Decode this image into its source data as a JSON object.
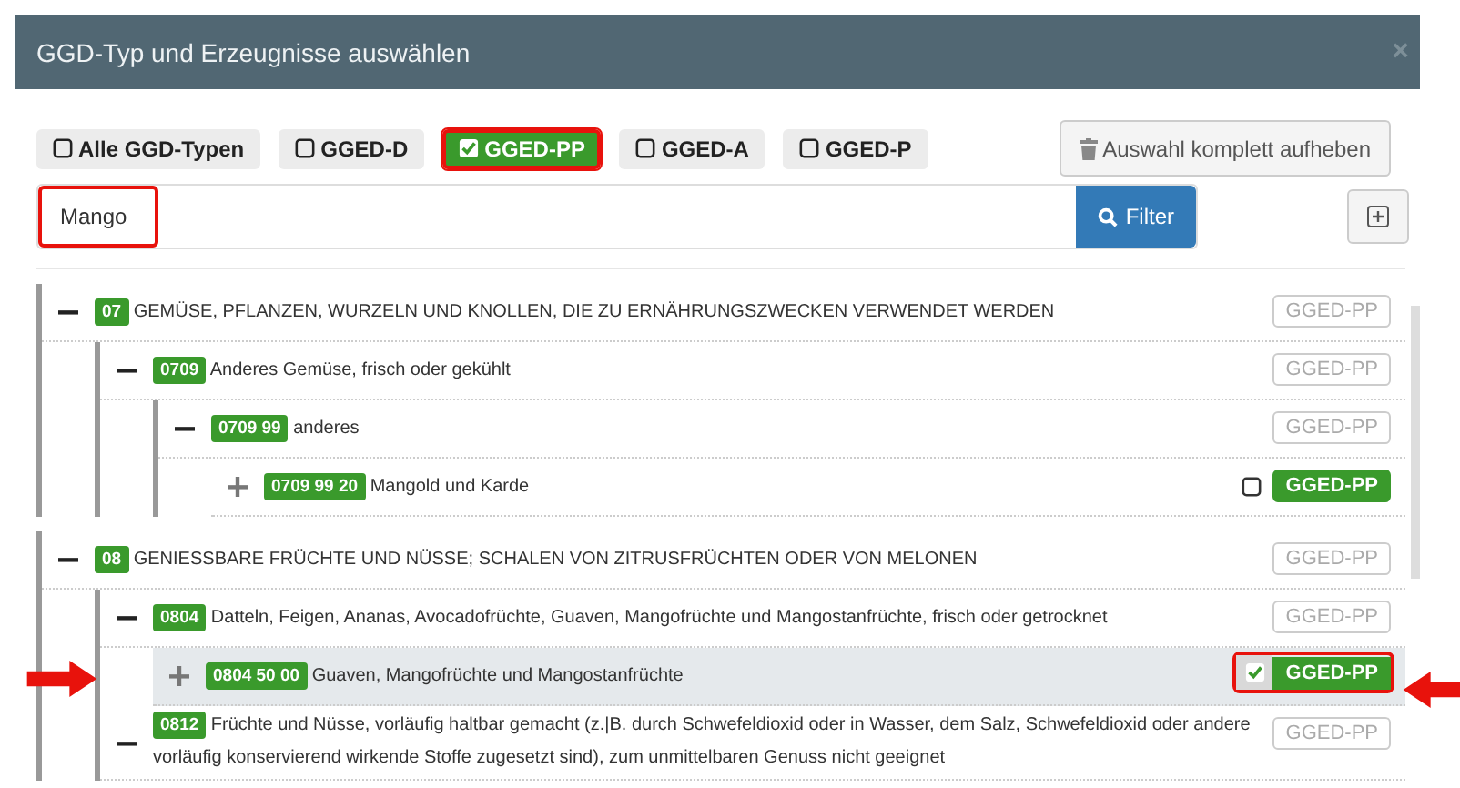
{
  "window": {
    "title": "GGD-Typ und Erzeugnisse auswählen",
    "close": "×"
  },
  "type_filters": [
    {
      "label": "Alle GGD-Typen",
      "checked": false,
      "highlighted": false
    },
    {
      "label": "GGED-D",
      "checked": false,
      "highlighted": false
    },
    {
      "label": "GGED-PP",
      "checked": true,
      "highlighted": true
    },
    {
      "label": "GGED-A",
      "checked": false,
      "highlighted": false
    },
    {
      "label": "GGED-P",
      "checked": false,
      "highlighted": false
    }
  ],
  "clear_button": {
    "label": "Auswahl komplett aufheben"
  },
  "search": {
    "value": "Mango",
    "highlighted": true
  },
  "filter_button": {
    "label": "Filter"
  },
  "tree": [
    {
      "code": "07",
      "text": "GEMÜSE, PFLANZEN, WURZELN UND KNOLLEN, DIE ZU ERNÄHRUNGSZWECKEN VERWENDET WERDEN",
      "expanded": true,
      "selected": false,
      "marked": false,
      "tag": {
        "label": "GGED-PP",
        "active": false,
        "highlighted": false
      },
      "children": [
        {
          "code": "0709",
          "text": "Anderes Gemüse, frisch oder gekühlt",
          "expanded": true,
          "selected": false,
          "marked": false,
          "tag": {
            "label": "GGED-PP",
            "active": false,
            "highlighted": false
          },
          "children": [
            {
              "code": "0709 99",
              "text": "anderes",
              "expanded": true,
              "selected": false,
              "marked": false,
              "tag": {
                "label": "GGED-PP",
                "active": false,
                "highlighted": false
              },
              "children": [
                {
                  "code": "0709 99 20",
                  "text": "Mangold und Karde",
                  "expanded": false,
                  "selected": false,
                  "marked": false,
                  "checked": false,
                  "tag": {
                    "label": "GGED-PP",
                    "active": true,
                    "highlighted": false
                  }
                }
              ]
            }
          ]
        }
      ]
    },
    {
      "code": "08",
      "text": "GENIESSBARE FRÜCHTE UND NÜSSE; SCHALEN VON ZITRUSFRÜCHTEN ODER VON MELONEN",
      "expanded": true,
      "selected": false,
      "marked": false,
      "tag": {
        "label": "GGED-PP",
        "active": false,
        "highlighted": false
      },
      "children": [
        {
          "code": "0804",
          "text": "Datteln, Feigen, Ananas, Avocadofrüchte, Guaven, Mangofrüchte und Mangostanfrüchte, frisch oder getrocknet",
          "expanded": true,
          "selected": false,
          "marked": false,
          "tag": {
            "label": "GGED-PP",
            "active": false,
            "highlighted": false
          },
          "children": [
            {
              "code": "0804 50 00",
              "text": "Guaven, Mangofrüchte und Mangostanfrüchte",
              "expanded": false,
              "selected": true,
              "marked": true,
              "checked": true,
              "tag": {
                "label": "GGED-PP",
                "active": true,
                "highlighted": true
              }
            }
          ]
        },
        {
          "code": "0812",
          "text": "Früchte und Nüsse, vorläufig haltbar gemacht (z.|B. durch Schwefeldioxid oder in Wasser, dem Salz, Schwefeldioxid oder andere vorläufig konservierend wirkende Stoffe zugesetzt sind), zum unmittelbaren Genuss nicht geeignet",
          "expanded": true,
          "selected": false,
          "marked": false,
          "tag": {
            "label": "GGED-PP",
            "active": false,
            "highlighted": false
          }
        }
      ]
    }
  ]
}
